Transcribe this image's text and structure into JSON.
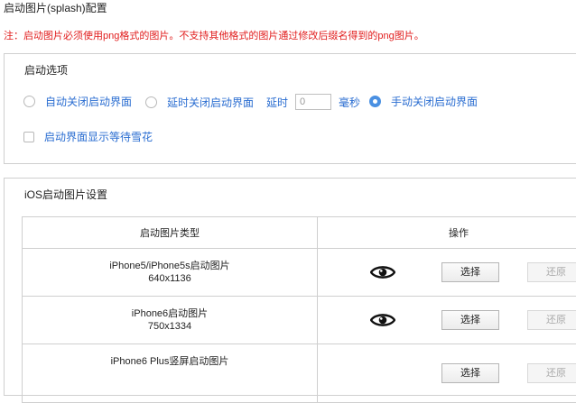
{
  "page": {
    "title": "启动图片(splash)配置",
    "notice": "注：启动图片必须使用png格式的图片。不支持其他格式的图片通过修改后缀名得到的png图片。"
  },
  "startup_options": {
    "title": "启动选项",
    "radios": [
      {
        "label": "自动关闭启动界面",
        "checked": false
      },
      {
        "label": "延时关闭启动界面",
        "checked": false
      },
      {
        "label": "手动关闭启动界面",
        "checked": true
      }
    ],
    "delay": {
      "label": "延时",
      "value": "0",
      "unit": "毫秒"
    },
    "checkbox": {
      "label": "启动界面显示等待雪花",
      "checked": false
    }
  },
  "ios": {
    "title": "iOS启动图片设置",
    "headers": {
      "type": "启动图片类型",
      "ops": "操作"
    },
    "rows": [
      {
        "name": "iPhone5/iPhone5s启动图片",
        "size": "640x1136",
        "select": "选择",
        "restore": "还原"
      },
      {
        "name": "iPhone6启动图片",
        "size": "750x1334",
        "select": "选择",
        "restore": "还原"
      },
      {
        "name": "iPhone6 Plus竖屏启动图片",
        "size": "",
        "select": "选择",
        "restore": "还原"
      }
    ]
  },
  "icons": {
    "preview": "eye-icon"
  },
  "colors": {
    "notice": "#e11d1d",
    "option_text": "#2a6dd1",
    "radio_checked": "#4a90e2"
  }
}
